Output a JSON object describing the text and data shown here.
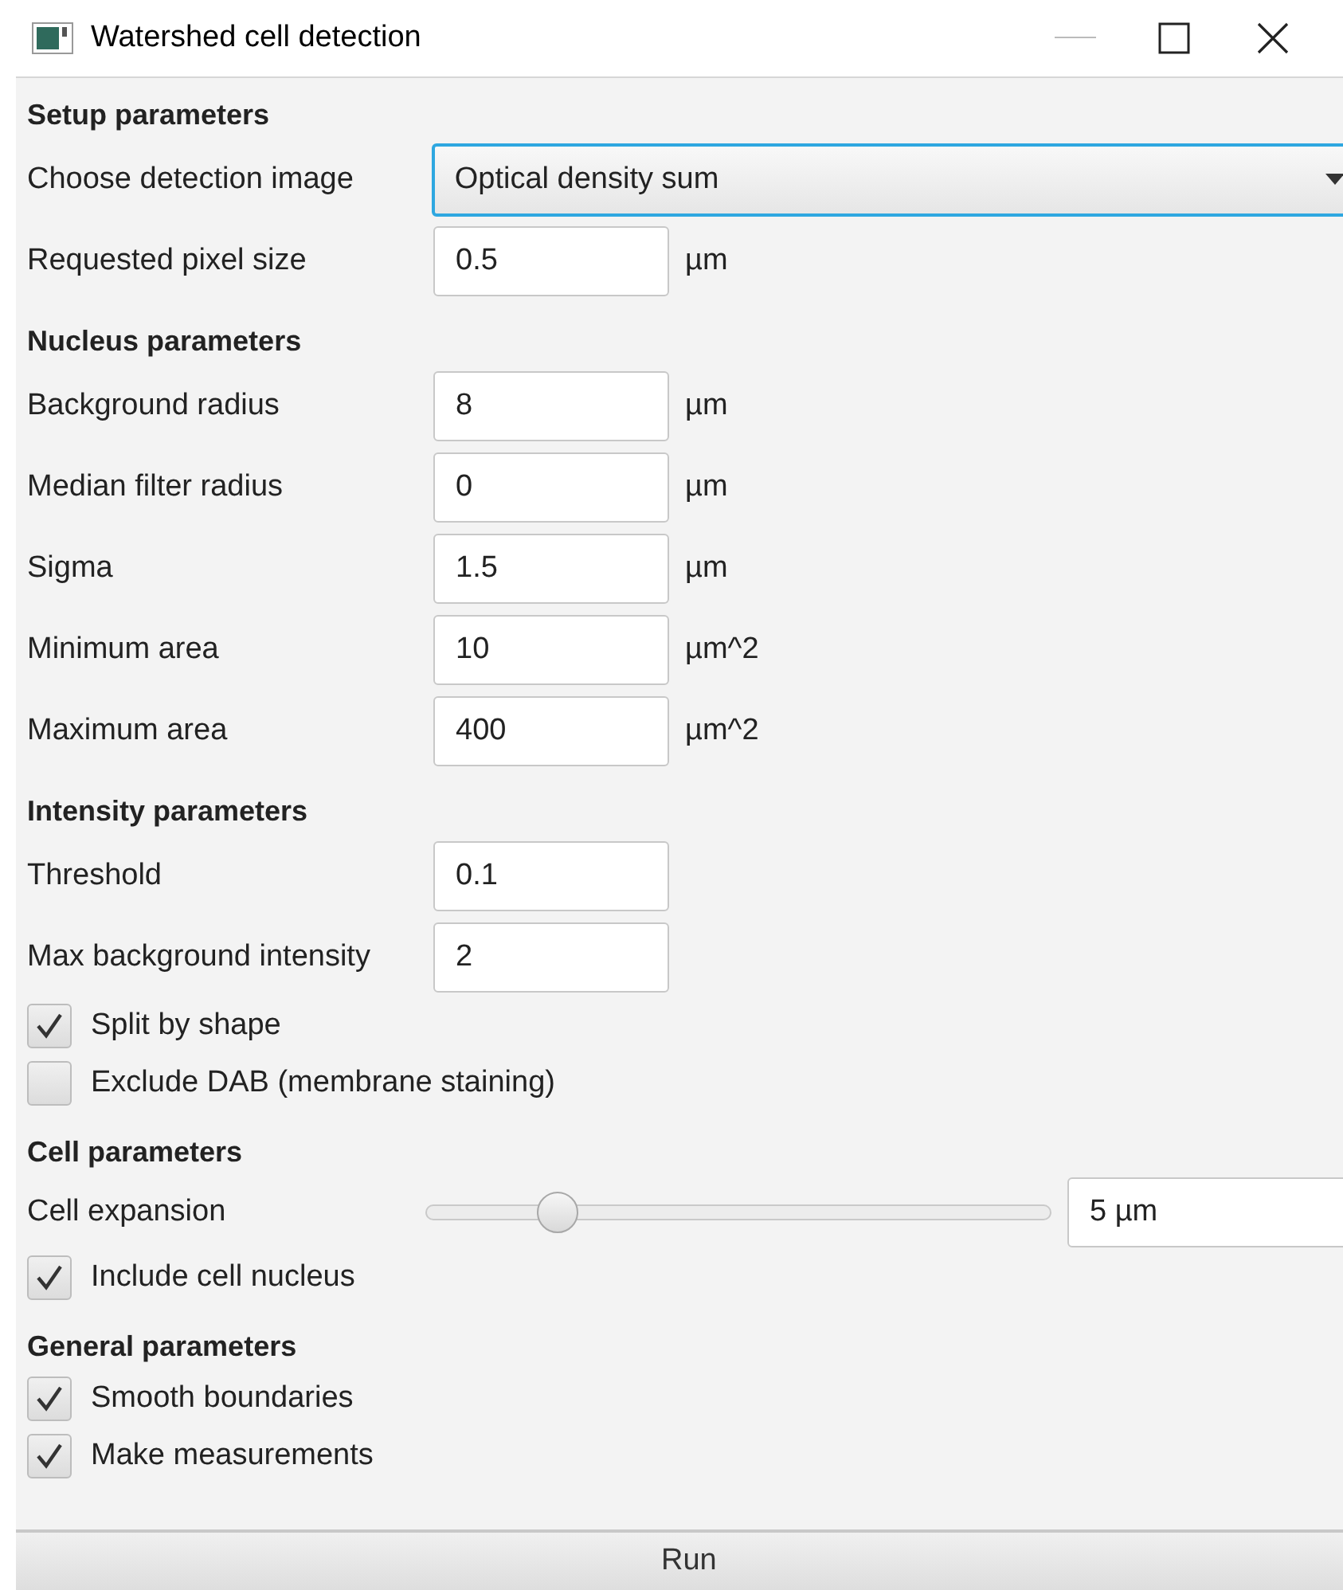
{
  "window": {
    "title": "Watershed cell detection"
  },
  "sections": [
    {
      "heading": "Setup parameters",
      "rows": [
        {
          "kind": "dropdown",
          "label": "Choose detection image",
          "value": "Optical density sum"
        },
        {
          "kind": "field",
          "label": "Requested pixel size",
          "value": "0.5",
          "unit": "µm"
        }
      ]
    },
    {
      "heading": "Nucleus parameters",
      "rows": [
        {
          "kind": "field",
          "label": "Background radius",
          "value": "8",
          "unit": "µm"
        },
        {
          "kind": "field",
          "label": "Median filter radius",
          "value": "0",
          "unit": "µm"
        },
        {
          "kind": "field",
          "label": "Sigma",
          "value": "1.5",
          "unit": "µm"
        },
        {
          "kind": "field",
          "label": "Minimum area",
          "value": "10",
          "unit": "µm^2"
        },
        {
          "kind": "field",
          "label": "Maximum area",
          "value": "400",
          "unit": "µm^2"
        }
      ]
    },
    {
      "heading": "Intensity parameters",
      "rows": [
        {
          "kind": "field",
          "label": "Threshold",
          "value": "0.1"
        },
        {
          "kind": "field",
          "label": "Max background intensity",
          "value": "2"
        },
        {
          "kind": "checkbox",
          "label": "Split by shape",
          "checked": true
        },
        {
          "kind": "checkbox",
          "label": "Exclude DAB (membrane staining)",
          "checked": false
        }
      ]
    },
    {
      "heading": "Cell parameters",
      "rows": [
        {
          "kind": "slider",
          "label": "Cell expansion",
          "level": 0.21,
          "value": "5 µm"
        },
        {
          "kind": "checkbox",
          "label": "Include cell nucleus",
          "checked": true
        }
      ]
    },
    {
      "heading": "General parameters",
      "rows": [
        {
          "kind": "checkbox",
          "label": "Smooth boundaries",
          "checked": true
        },
        {
          "kind": "checkbox",
          "label": "Make measurements",
          "checked": true
        }
      ]
    }
  ],
  "run_button": "Run"
}
